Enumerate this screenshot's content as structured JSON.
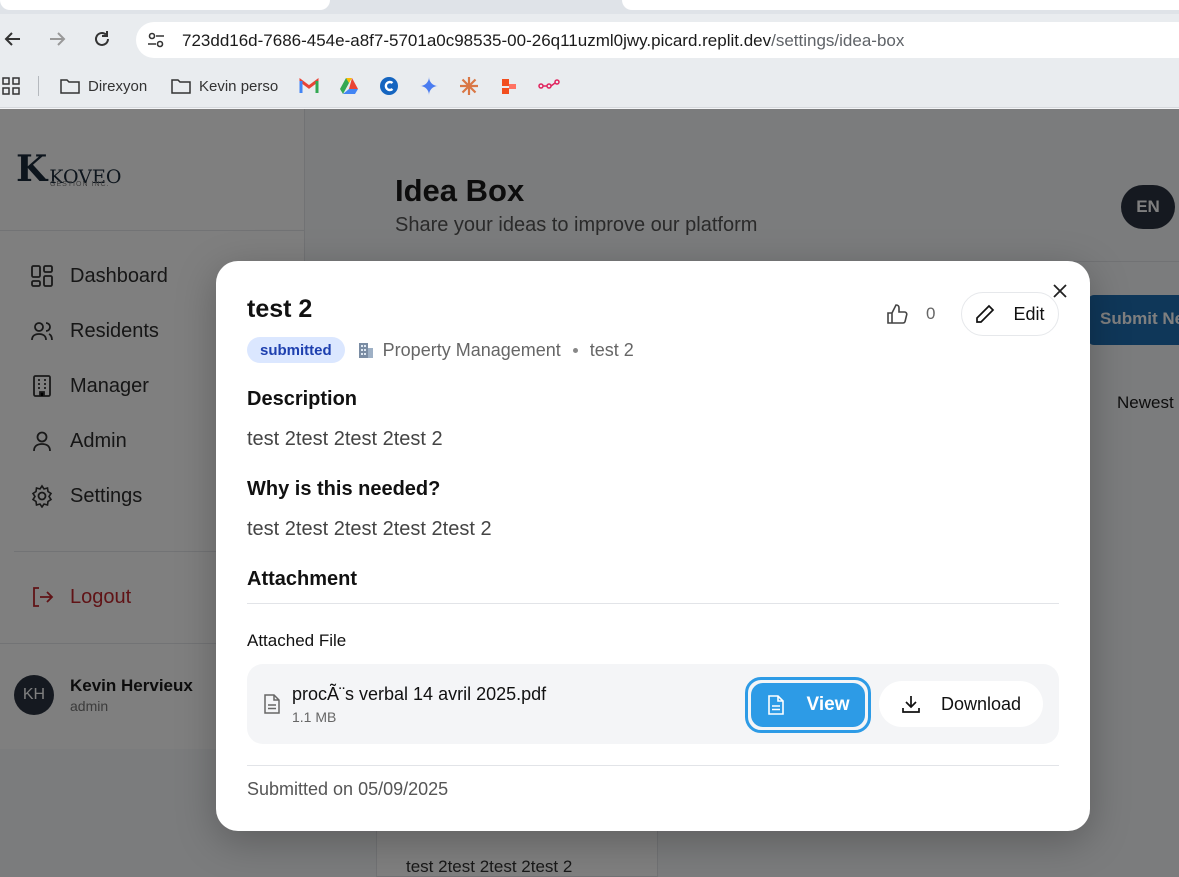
{
  "browser": {
    "url_host": "723dd16d-7686-454e-a8f7-5701a0c98535-00-26q11uzml0jwy.picard.replit.dev",
    "url_path": "/settings/idea-box",
    "bookmarks": [
      "Direxyon",
      "Kevin perso"
    ],
    "bookmark_icons": [
      "gmail-icon",
      "drive-icon",
      "c-icon",
      "gemini-icon",
      "claude-icon",
      "figma-icon",
      "flow-icon"
    ]
  },
  "sidebar": {
    "logo_letter": "K",
    "logo_name": "KOVEO",
    "logo_sub": "GESTION INC.",
    "items": [
      {
        "label": "Dashboard"
      },
      {
        "label": "Residents"
      },
      {
        "label": "Manager"
      },
      {
        "label": "Admin"
      },
      {
        "label": "Settings"
      }
    ],
    "logout": "Logout",
    "user": {
      "initials": "KH",
      "name": "Kevin Hervieux",
      "role": "admin"
    }
  },
  "page": {
    "title": "Idea Box",
    "subtitle": "Share your ideas to improve our platform",
    "lang": "EN",
    "submit_label": "Submit Ne",
    "sort_label": "Newest",
    "bg_card_text": "test 2test 2test 2test 2"
  },
  "modal": {
    "title": "test 2",
    "like_count": "0",
    "edit_label": "Edit",
    "status": "submitted",
    "category": "Property Management",
    "meta_name": "test 2",
    "description_heading": "Description",
    "description": "test 2test 2test 2test 2",
    "why_heading": "Why is this needed?",
    "why": "test 2test 2test 2test 2test 2",
    "attachment_heading": "Attachment",
    "attached_file_label": "Attached File",
    "file_name": "procÃ¨s verbal 14 avril 2025.pdf",
    "file_size": "1.1 MB",
    "view_label": "View",
    "download_label": "Download",
    "submitted_on": "Submitted on 05/09/2025"
  },
  "colors": {
    "accent": "#2d9be6",
    "badge_bg": "#dbe7ff",
    "badge_text": "#1e40af",
    "logout": "#c0262d"
  }
}
